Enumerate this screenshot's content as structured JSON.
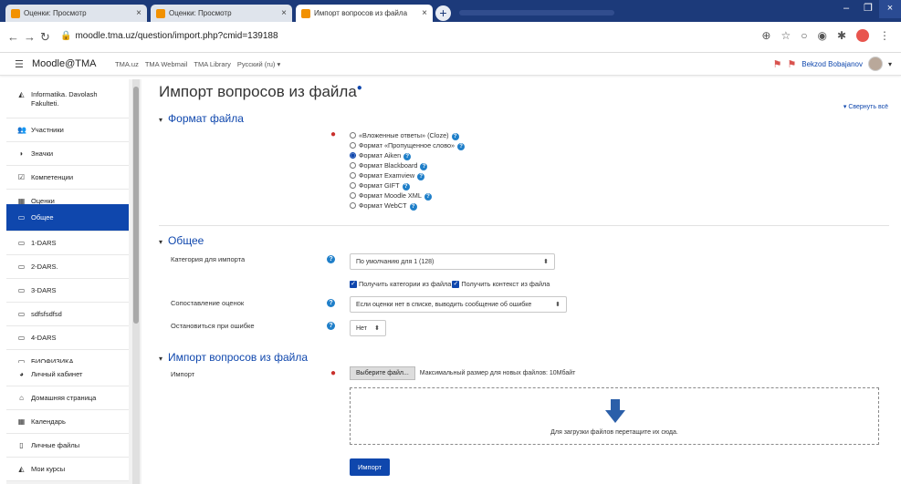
{
  "browser": {
    "tabs": [
      {
        "title": "Оценки: Просмотр",
        "active": false
      },
      {
        "title": "Оценки: Просмотр",
        "active": false
      },
      {
        "title": "Импорт вопросов из файла",
        "active": true
      }
    ],
    "new_tab": "+",
    "url_host": "moodle.tma.uz",
    "url_path": "/question/import.php?cmid=139188"
  },
  "navbar": {
    "brand": "Moodle@TMA",
    "links": [
      "TMA.uz",
      "TMA Webmail",
      "TMA Library",
      "Русский (ru) ▾"
    ],
    "user_name": "Bekzod Bobajanov"
  },
  "drawer": {
    "course": "Informatika. Davolash Fakulteti.",
    "items": [
      {
        "label": "Участники",
        "icon": "users-icon",
        "glyph": "👥",
        "active": false
      },
      {
        "label": "Значки",
        "icon": "badge-icon",
        "glyph": "◗",
        "active": false
      },
      {
        "label": "Компетенции",
        "icon": "check-square-icon",
        "glyph": "☑",
        "active": false
      },
      {
        "label": "Оценки",
        "icon": "table-icon",
        "glyph": "▦",
        "active": false
      },
      {
        "label": "Общее",
        "icon": "folder-icon",
        "glyph": "▭",
        "active": true
      },
      {
        "label": "1-DARS",
        "icon": "folder-icon",
        "glyph": "▭",
        "active": false
      },
      {
        "label": "2-DARS.",
        "icon": "folder-icon",
        "glyph": "▭",
        "active": false
      },
      {
        "label": "3-DARS",
        "icon": "folder-icon",
        "glyph": "▭",
        "active": false
      },
      {
        "label": "sdfsfsdfsd",
        "icon": "folder-icon",
        "glyph": "▭",
        "active": false
      },
      {
        "label": "4-DARS",
        "icon": "folder-icon",
        "glyph": "▭",
        "active": false
      },
      {
        "label": "БИОФИЗИКА",
        "icon": "folder-icon",
        "glyph": "▭",
        "active": false
      }
    ],
    "items2": [
      {
        "label": "Личный кабинет",
        "icon": "dashboard-icon",
        "glyph": "◕"
      },
      {
        "label": "Домашняя страница",
        "icon": "home-icon",
        "glyph": "⌂"
      },
      {
        "label": "Календарь",
        "icon": "calendar-icon",
        "glyph": "▦"
      },
      {
        "label": "Личные файлы",
        "icon": "file-icon",
        "glyph": "▯"
      },
      {
        "label": "Мои курсы",
        "icon": "graduation-cap-icon",
        "glyph": "◭"
      }
    ]
  },
  "page": {
    "title": "Импорт вопросов из файла",
    "collapse_all": "▾ Свернуть всё",
    "section_format": "Формат файла",
    "formats": [
      {
        "label": "«Вложенные ответы» (Cloze)",
        "checked": false
      },
      {
        "label": "Формат «Пропущенное слово»",
        "checked": false
      },
      {
        "label": "Формат Aiken",
        "checked": true
      },
      {
        "label": "Формат Blackboard",
        "checked": false
      },
      {
        "label": "Формат Examview",
        "checked": false
      },
      {
        "label": "Формат GIFT",
        "checked": false
      },
      {
        "label": "Формат Moodle XML",
        "checked": false
      },
      {
        "label": "Формат WebCT",
        "checked": false
      }
    ],
    "section_general": "Общее",
    "category_label": "Категория для импорта",
    "category_value": "По умолчанию для 1 (128)",
    "chk_category": "Получить категории из файла",
    "chk_context": "Получить контекст из файла",
    "matchgrades_label": "Сопоставление оценок",
    "matchgrades_value": "Если оценки нет в списке, выводить сообщение об ошибке",
    "stoponerror_label": "Остановиться при ошибке",
    "stoponerror_value": "Нет",
    "section_import": "Импорт вопросов из файла",
    "import_label": "Импорт",
    "choose_file": "Выберите файл...",
    "max_size": "Максимальный размер для новых файлов: 10Мбайт",
    "drop_text": "Для загрузки файлов перетащите их сюда.",
    "import_button": "Импорт"
  },
  "colors": {
    "brand": "#0f47ad",
    "required": "#c9302c",
    "help": "#1f7fc9"
  }
}
